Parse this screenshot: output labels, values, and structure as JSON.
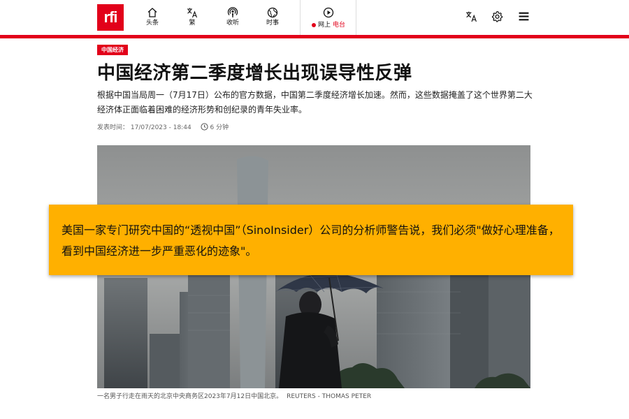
{
  "header": {
    "logo": "rfi",
    "nav": [
      {
        "label": "头条",
        "icon": "home-icon"
      },
      {
        "label": "繁",
        "icon": "translate-icon"
      },
      {
        "label": "收听",
        "icon": "podcast-icon"
      },
      {
        "label": "时事",
        "icon": "globe-icon"
      }
    ],
    "live": {
      "prefix": "网上",
      "suffix": "电台",
      "icon": "play-icon"
    },
    "right_icons": [
      "translate-icon",
      "gear-icon",
      "menu-icon"
    ],
    "accent": "#e2001a"
  },
  "article": {
    "tag": "中国经济",
    "title": "中国经济第二季度增长出现误导性反弹",
    "lead": "根据中国当局周一（7月17日）公布的官方数据，中国第二季度经济增长加速。然而，这些数据掩盖了这个世界第二大经济体正面临着困难的经济形势和创纪录的青年失业率。",
    "published_label": "发表时间：",
    "published": "17/07/2023 - 18:44",
    "duration": "6 分钟",
    "caption": "一名男子行走在雨天的北京中央商务区2023年7月12日中国北京。",
    "credit": "REUTERS - THOMAS PETER"
  },
  "overlay": {
    "text": "美国一家专门研究中国的“透视中国”（SinoInsider）公司的分析师警告说，我们必须\"做好心理准备，看到中国经济进一步严重恶化的迹象\"。",
    "color": "#ffb000"
  }
}
